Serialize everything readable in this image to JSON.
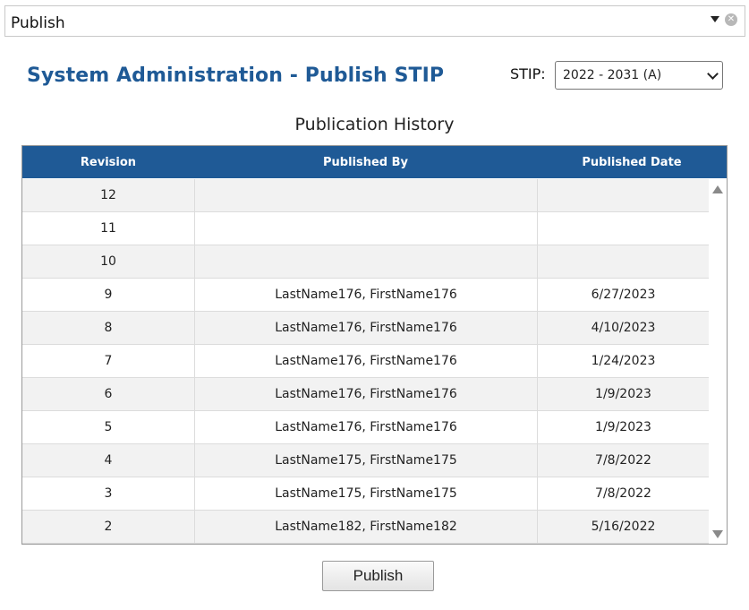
{
  "panel": {
    "title": "Publish"
  },
  "page": {
    "title": "System Administration - Publish STIP"
  },
  "stip": {
    "label": "STIP:",
    "selected": "2022 - 2031 (A)"
  },
  "history": {
    "title": "Publication History",
    "columns": [
      "Revision",
      "Published By",
      "Published Date"
    ],
    "rows": [
      {
        "revision": "12",
        "by": "",
        "date": ""
      },
      {
        "revision": "11",
        "by": "",
        "date": ""
      },
      {
        "revision": "10",
        "by": "",
        "date": ""
      },
      {
        "revision": "9",
        "by": "LastName176, FirstName176",
        "date": "6/27/2023"
      },
      {
        "revision": "8",
        "by": "LastName176, FirstName176",
        "date": "4/10/2023"
      },
      {
        "revision": "7",
        "by": "LastName176, FirstName176",
        "date": "1/24/2023"
      },
      {
        "revision": "6",
        "by": "LastName176, FirstName176",
        "date": "1/9/2023"
      },
      {
        "revision": "5",
        "by": "LastName176, FirstName176",
        "date": "1/9/2023"
      },
      {
        "revision": "4",
        "by": "LastName175, FirstName175",
        "date": "7/8/2022"
      },
      {
        "revision": "3",
        "by": "LastName175, FirstName175",
        "date": "7/8/2022"
      },
      {
        "revision": "2",
        "by": "LastName182, FirstName182",
        "date": "5/16/2022"
      }
    ]
  },
  "actions": {
    "publish_label": "Publish"
  },
  "colors": {
    "accent": "#1f5a96",
    "row_alt": "#f2f2f2"
  }
}
